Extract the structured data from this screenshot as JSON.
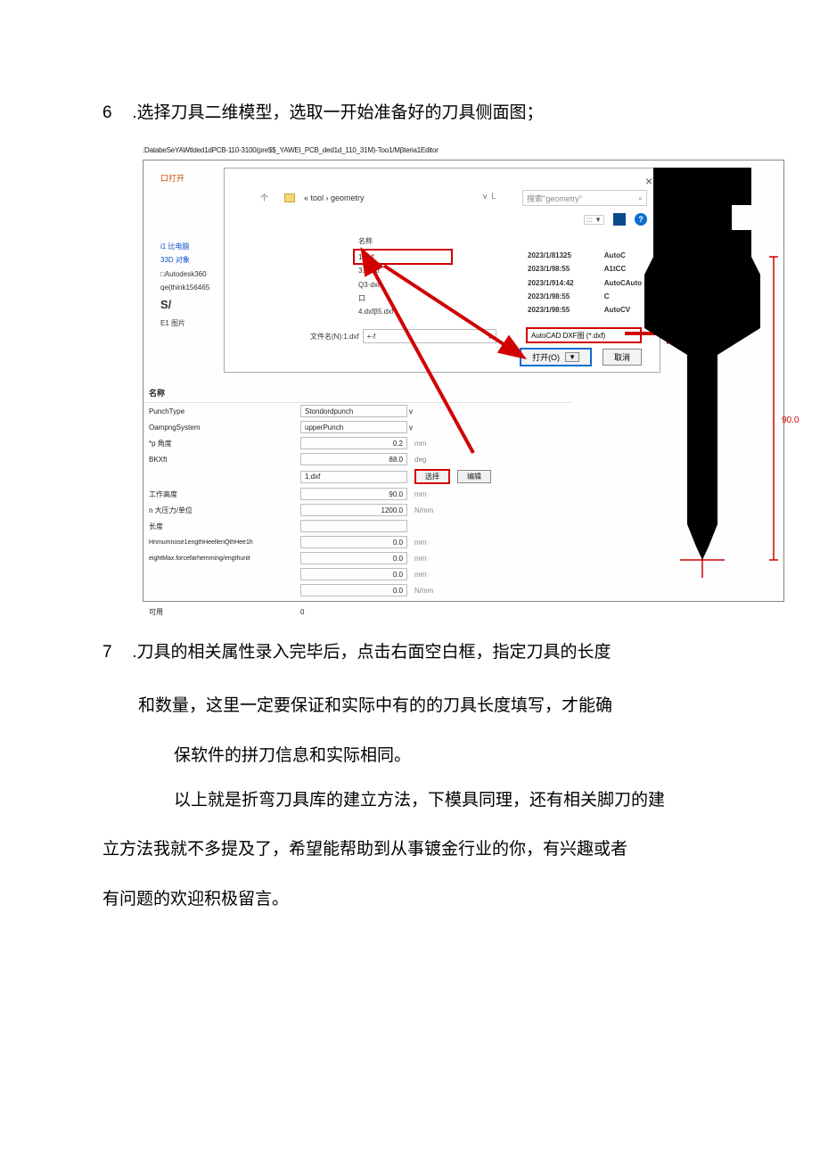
{
  "step6": {
    "num": "6",
    "text": ".选择刀具二维模型，选取一开始准备好的刀具侧面图；"
  },
  "screenshot_path": ":DatabeSeYAWtlded1dPCB-110-3100(pre$$_YAWEI_PCB_ded1d_110_31M)-Too1/Mβteria1Editor",
  "dialog": {
    "title": "口打开",
    "close": "×",
    "up": "个",
    "breadcrumb": "« tool › geometry",
    "refresh": "v  ㇄",
    "search_placeholder": "搜索\"geometry\"",
    "search_icon": "⌕",
    "toolbar": {
      "list": "::: ▼",
      "help": "?"
    },
    "header": {
      "name": "名称",
      "mod": "",
      "type": ""
    },
    "files": [
      {
        "name": "1.dxf",
        "date": "2023/1/81325",
        "type": "AutoC"
      },
      {
        "name": "3.1.dxf",
        "date": "2023/1/98:55",
        "type": "A1tCC"
      },
      {
        "name": "Q3·dxf",
        "date": "2023/1/914:42",
        "type": "AutoCAuto"
      },
      {
        "name": "口",
        "date": "2023/1/98:55",
        "type": "C"
      },
      {
        "name": "4.dxfβ5.dxf",
        "date": "2023/1/98:55",
        "type": "AutoCV"
      }
    ],
    "filename_label": "文件名(N):1.dxf",
    "filename_suffix": "+-f",
    "filetype": "AutoCAD DXF图 (*.dxf)",
    "open_btn": "打开(O)",
    "cancel_btn": "取消",
    "nav": [
      {
        "txt": "i1 比电脑",
        "cls": "blue"
      },
      {
        "txt": "33D 对象",
        "cls": "blue"
      },
      {
        "txt": "□Autodesk360",
        "cls": ""
      },
      {
        "txt": "qe(think156465",
        "cls": ""
      },
      {
        "txt": "S/",
        "cls": "s-big"
      },
      {
        "txt": "E1 图片",
        "cls": ""
      }
    ]
  },
  "props": {
    "header": "名称",
    "rows": [
      {
        "label": "PunchType",
        "value": "Stondordpunch",
        "unit": "",
        "dropdown": true
      },
      {
        "label": "OampngSystem",
        "value": "upperPunch",
        "unit": "",
        "dropdown": true
      },
      {
        "label": "*p 角度",
        "value": "0.2",
        "unit": "mm"
      },
      {
        "label": "BKXft",
        "value": "88.0",
        "unit": "deg"
      },
      {
        "label": "",
        "value": "1.dxf",
        "unit": "",
        "select_btn": "选择",
        "edit_btn": "编辑",
        "highlight": true
      },
      {
        "label": "工作高度",
        "value": "90.0",
        "unit": "mm"
      },
      {
        "label": "n 大压力/单位",
        "value": "1200.0",
        "unit": "N/mm"
      },
      {
        "label": "长度",
        "value": "",
        "unit": ""
      },
      {
        "label": "Hnmumnose1engthHeellenQthHee1h",
        "value": "0.0",
        "unit": "mm"
      },
      {
        "label": "eightMax.forcefarhemming/engthunit",
        "value": "0.0",
        "unit": "mm"
      },
      {
        "label": "",
        "value": "0.0",
        "unit": "mm"
      },
      {
        "label": "",
        "value": "0.0",
        "unit": "N/mm"
      },
      {
        "label": "可用",
        "value": "0",
        "unit": ""
      }
    ]
  },
  "tool_dim": "90.0",
  "step7": {
    "num": "7",
    "line1": ".刀具的相关属性录入完毕后，点击右面空白框，指定刀具的长度",
    "line2": "和数量，这里一定要保证和实际中有的的刀具长度填写，才能确",
    "line3": "保软件的拼刀信息和实际相同。"
  },
  "para": {
    "l1": "以上就是折弯刀具库的建立方法，下模具同理，还有相关脚刀的建",
    "l2": "立方法我就不多提及了，希望能帮助到从事镀金行业的你，有兴趣或者",
    "l3": "有问题的欢迎积极留言。"
  }
}
